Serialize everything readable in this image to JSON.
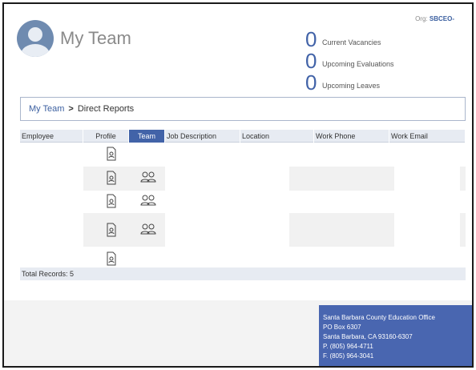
{
  "header": {
    "title": "My Team",
    "org_label": "Org:",
    "org_value": "SBCEO-",
    "stats": [
      {
        "value": "0",
        "label": "Current Vacancies"
      },
      {
        "value": "0",
        "label": "Upcoming Evaluations"
      },
      {
        "value": "0",
        "label": "Upcoming Leaves"
      }
    ]
  },
  "breadcrumb": {
    "root": "My Team",
    "separator": ">",
    "current": "Direct Reports"
  },
  "table": {
    "columns": [
      "Employee",
      "Profile",
      "Team",
      "Job Description",
      "Location",
      "Work Phone",
      "Work Email"
    ],
    "active_column": "Team",
    "rows": [
      {
        "profile_icon": "profile-document-icon",
        "team_icon": null
      },
      {
        "profile_icon": "profile-document-icon",
        "team_icon": "team-people-icon"
      },
      {
        "profile_icon": "profile-document-icon",
        "team_icon": "team-people-icon"
      },
      {
        "profile_icon": "profile-document-icon",
        "team_icon": "team-people-icon"
      },
      {
        "profile_icon": "profile-document-icon",
        "team_icon": null
      }
    ],
    "total_records": "Total Records: 5"
  },
  "contact": {
    "org_name": "Santa Barbara County Education Office",
    "po_box": "PO Box 6307",
    "city": "Santa Barbara, CA 93160-6307",
    "phone": "P. (805) 964-4711",
    "fax": "F. (805) 964-3041"
  },
  "colors": {
    "accent": "#4263a8",
    "header_bg": "#e7ebf2",
    "contact_bg": "#4966b0"
  }
}
